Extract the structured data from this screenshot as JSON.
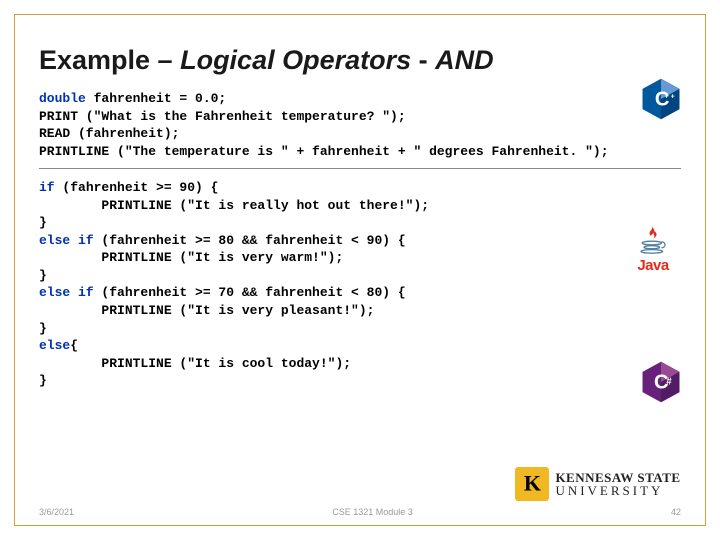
{
  "title": {
    "plain1": "Example – ",
    "ital1": "Logical Operators",
    "plain2": " - ",
    "ital2": "AND"
  },
  "code_top": {
    "kw1": "double",
    "l1_rest": " fahrenheit = 0.0;",
    "l2": "PRINT (\"What is the Fahrenheit temperature? \");",
    "l3": "READ (fahrenheit);",
    "l4": "PRINTLINE (\"The temperature is \" + fahrenheit + \" degrees Fahrenheit. \");"
  },
  "code_bot": {
    "kw_if": "if",
    "kw_elseif": "else if",
    "kw_else": "else",
    "l1_rest": " (fahrenheit >= 90) {",
    "l2": "        PRINTLINE (\"It is really hot out there!\");",
    "l3": "}",
    "l4_rest": " (fahrenheit >= 80 && fahrenheit < 90) {",
    "l5": "        PRINTLINE (\"It is very warm!\");",
    "l6": "}",
    "l7_rest": " (fahrenheit >= 70 && fahrenheit < 80) {",
    "l8": "        PRINTLINE (\"It is very pleasant!\");",
    "l9": "}",
    "l10_rest": "{",
    "l11": "        PRINTLINE (\"It is cool today!\");",
    "l12": "}"
  },
  "footer": {
    "left": "3/6/2021",
    "center": "CSE 1321 Module 3",
    "right": "42"
  },
  "logos": {
    "java_text": "Java",
    "ksu_line1": "KENNESAW STATE",
    "ksu_line2": "UNIVERSITY"
  }
}
